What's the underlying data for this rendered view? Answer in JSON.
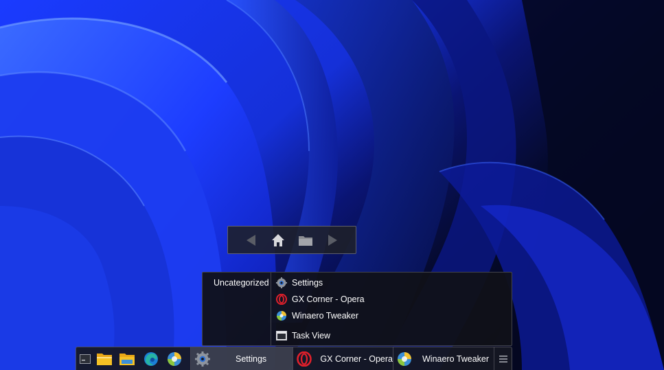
{
  "navbar": {
    "back_icon": "back-arrow-icon",
    "home_icon": "home-icon",
    "folder_icon": "folder-icon",
    "forward_icon": "forward-arrow-icon"
  },
  "menu": {
    "category": "Uncategorized",
    "items": [
      {
        "label": "Settings",
        "icon": "settings-gear-icon"
      },
      {
        "label": "GX Corner - Opera",
        "icon": "opera-icon"
      },
      {
        "label": "Winaero Tweaker",
        "icon": "winaero-tweaker-icon"
      },
      {
        "label": "Task View",
        "icon": "task-view-icon"
      }
    ]
  },
  "taskbar": {
    "pinned": [
      {
        "name": "show-desktop-icon"
      },
      {
        "name": "file-explorer-icon"
      },
      {
        "name": "file-explorer-icon"
      },
      {
        "name": "edge-icon"
      },
      {
        "name": "winaero-tweaker-icon"
      }
    ],
    "tasks": [
      {
        "label": "Settings",
        "icon": "settings-gear-icon",
        "active": true
      },
      {
        "label": "GX Corner - Opera",
        "icon": "opera-icon",
        "active": false
      },
      {
        "label": "Winaero Tweaker",
        "icon": "winaero-tweaker-icon",
        "active": false
      }
    ],
    "menu_icon": "hamburger-menu-icon"
  },
  "colors": {
    "wallpaper_blue": "#1a3cff",
    "wallpaper_dark": "#05081f",
    "opera_red": "#e0202b",
    "folder_yellow": "#f5c125",
    "edge_teal": "#27b3a3"
  }
}
